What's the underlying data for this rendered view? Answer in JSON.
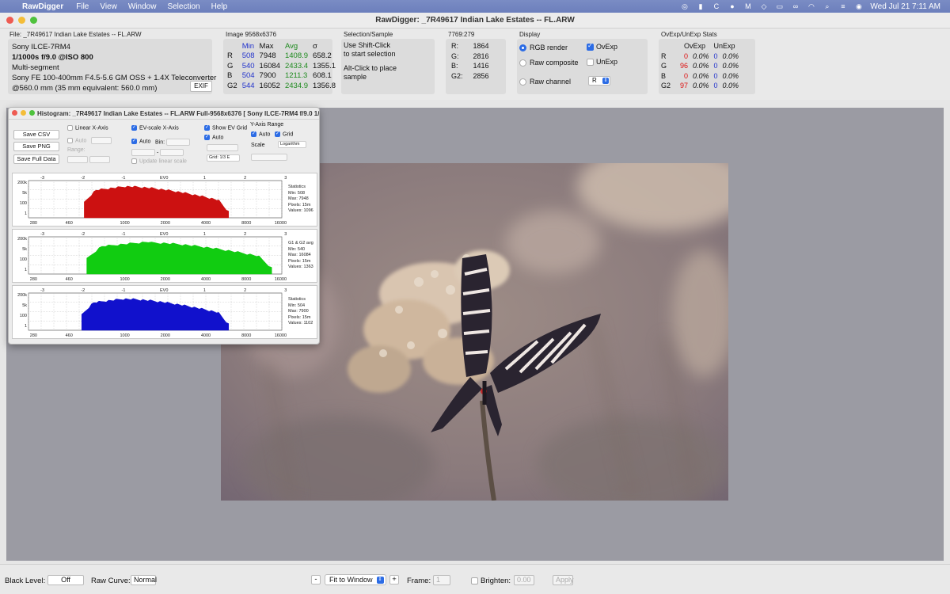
{
  "menubar": {
    "app": "RawDigger",
    "items": [
      "File",
      "View",
      "Window",
      "Selection",
      "Help"
    ],
    "datetime": "Wed Jul 21  7:11 AM"
  },
  "window": {
    "title": "RawDigger: _7R49617 Indian Lake Estates -- FL.ARW"
  },
  "file_info": {
    "label": "File: _7R49617 Indian Lake Estates -- FL.ARW",
    "camera": "Sony ILCE-7RM4",
    "exposure": "1/1000s f/9.0 @ISO 800",
    "mode": "Multi-segment",
    "lens": "Sony FE 100-400mm F4.5-5.6 GM OSS + 1.4X Teleconverter",
    "focal": "@560.0 mm (35 mm equivalent: 560.0 mm)",
    "exif_button": "EXIF"
  },
  "image_stats": {
    "label": "Image 9568x6376",
    "headers": [
      "",
      "Min",
      "Max",
      "Avg",
      "σ"
    ],
    "rows": [
      [
        "R",
        "508",
        "7948",
        "1408.9",
        "658.2"
      ],
      [
        "G",
        "540",
        "16084",
        "2433.4",
        "1355.1"
      ],
      [
        "B",
        "504",
        "7900",
        "1211.3",
        "608.1"
      ],
      [
        "G2",
        "544",
        "16052",
        "2434.9",
        "1356.8"
      ]
    ]
  },
  "selection": {
    "label": "Selection/Sample",
    "line1": "Use Shift-Click",
    "line2": "to start selection",
    "line3": "Alt-Click to place",
    "line4": "sample"
  },
  "pixel": {
    "label": "7769:279",
    "rows": [
      [
        "R:",
        "1864"
      ],
      [
        "G:",
        "2816"
      ],
      [
        "B:",
        "1416"
      ],
      [
        "G2:",
        "2856"
      ]
    ]
  },
  "display": {
    "label": "Display",
    "rgb_render": "RGB render",
    "raw_composite": "Raw composite",
    "raw_channel": "Raw channel",
    "ovexp": "OvExp",
    "unexp": "UnExp",
    "channel_value": "R"
  },
  "ovexp_stats": {
    "label": "OvExp/UnExp Stats",
    "headers": [
      "",
      "OvExp",
      "",
      "UnExp"
    ],
    "rows": [
      [
        "R",
        "0",
        "0.0%",
        "0",
        "0.0%"
      ],
      [
        "G",
        "96",
        "0.0%",
        "0",
        "0.0%"
      ],
      [
        "B",
        "0",
        "0.0%",
        "0",
        "0.0%"
      ],
      [
        "G2",
        "97",
        "0.0%",
        "0",
        "0.0%"
      ]
    ]
  },
  "histogram": {
    "title": "Histogram: _7R49617 Indian Lake Estates -- FL.ARW Full-9568x6376 [ Sony ILCE-7RM4 f/9.0 1/1000...",
    "save_csv": "Save CSV",
    "save_png": "Save PNG",
    "save_full": "Save Full Data",
    "linear_x": "Linear X-Axis",
    "auto": "Auto",
    "range": "Range:",
    "ev_scale": "EV-scale X-Axis",
    "bin": "Bin:",
    "update_linear": "Update linear scale",
    "show_ev_grid": "Show EV Grid",
    "grid_select": "Grid: 1/3 E",
    "y_axis_range": "Y-Axis Range",
    "grid": "Grid",
    "scale": "Scale",
    "scale_value": "Logarithm",
    "ev_top_ticks": [
      "-3",
      "-2",
      "-1",
      "EV0",
      "1",
      "2",
      "3"
    ],
    "y_ticks": [
      "200k",
      "5k",
      "100",
      "1"
    ],
    "x_ticks": [
      "280",
      "460",
      "1000",
      "2000",
      "4000",
      "8000",
      "16000"
    ],
    "panels": [
      {
        "color": "#cc1111",
        "stats": [
          "Statistics",
          "Min: 508",
          "Max: 7948",
          "Pixels: 15m",
          "Values: 1096"
        ]
      },
      {
        "color": "#11cc11",
        "stats": [
          "G1 & G2 avg",
          "Min: 540",
          "Max: 16084",
          "Pixels: 15m",
          "Values: 1363"
        ]
      },
      {
        "color": "#1111cc",
        "stats": [
          "Statistics",
          "Min: 504",
          "Max: 7900",
          "Pixels: 15m",
          "Values: 1102"
        ]
      }
    ]
  },
  "bottom": {
    "black_level": "Black Level:",
    "black_value": "Off",
    "raw_curve": "Raw Curve:",
    "raw_curve_value": "Normal",
    "minus": "-",
    "fit": "Fit to Window",
    "plus": "+",
    "frame": "Frame:",
    "frame_value": "1",
    "brighten": "Brighten:",
    "brighten_value": "0.00",
    "apply": "Apply"
  }
}
